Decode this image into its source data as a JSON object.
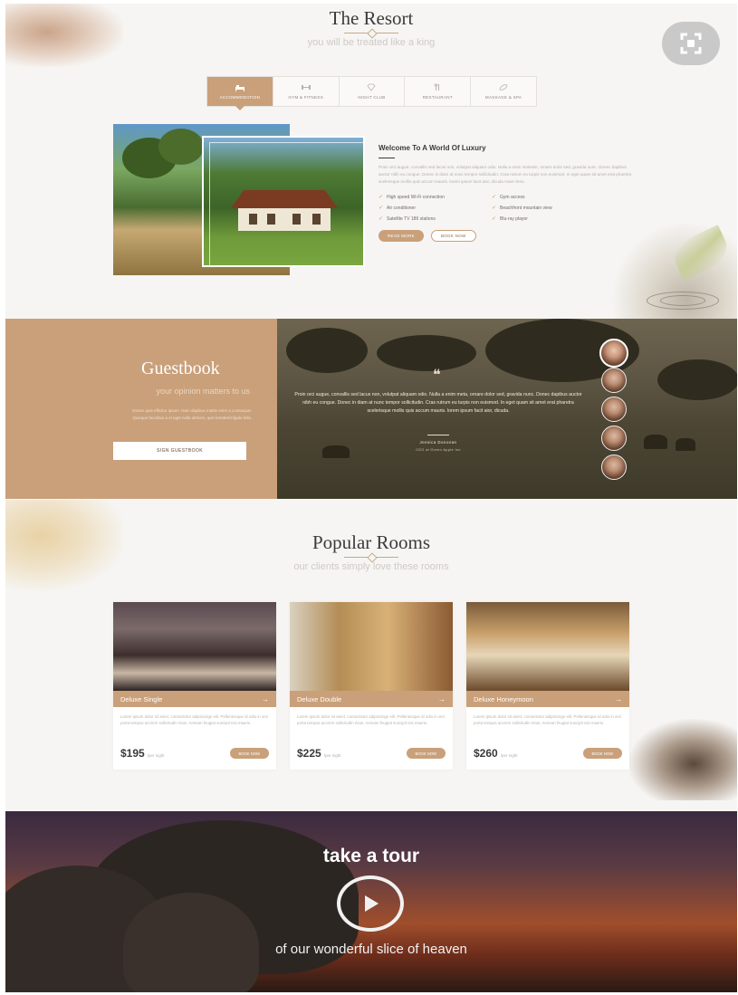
{
  "resort": {
    "title": "The Resort",
    "subtitle": "you will be treated like a king",
    "tabs": [
      {
        "label": "Accommodation",
        "icon": "bed-icon",
        "active": true
      },
      {
        "label": "Gym & Fitness",
        "icon": "dumbbell-icon",
        "active": false
      },
      {
        "label": "Night Club",
        "icon": "diamond-icon",
        "active": false
      },
      {
        "label": "Restaurant",
        "icon": "cutlery-icon",
        "active": false
      },
      {
        "label": "Massage & Spa",
        "icon": "leaf-icon",
        "active": false
      }
    ],
    "welcome_title": "Welcome To A World Of Luxury",
    "welcome_text": "Proin orci augue, convallis sed lacus non, volutpat aliquam odio. Nulla a enim molestie, ornare dolor sed, gravida nunc. Donec dapibus auctor nibh eu congue. Donec in diam at nunc tempor sollicitudin. Cras rutrum eu turpis non euismod. In eget quam sit amet erat pharetra scelerisque mollis quis accum mauris. lorem ipsum facit aior, dicuda maen leno.",
    "features": [
      "High speed Wi-Fi connection",
      "Gym access",
      "Air conditioner",
      "Beachfront mountain view",
      "Satellite TV 186 stations",
      "Blu-ray player"
    ],
    "read_more": "Read more",
    "book_now": "Book now"
  },
  "guestbook": {
    "title": "Guestbook",
    "subtitle": "your opinion matters to us",
    "description": "Donec quis efficitur ipsum. Nam dapibus mattis enim a consequat. Quisque faucibus a id eget nulla ultrices, quis hendrerit ligula felis.",
    "sign_button": "Sign guestbook",
    "quote": "Proin orci augue, convallis sed lacus non, volutpat aliquam odio. Nulla a enim meta, ornare dolor sed, gravida nunc. Donec dapibus auctor nibh eu congue. Donec in diam at nunc tempor sollicitudin. Cras rutrum eu turpis non euismod. In eget quam sit amet erat pharetra scelerisque mollis quis accum mauris. lorem ipsum facit aior, dicuda.",
    "author_name": "Jessica Donovan",
    "author_role": "CEO at Green Apple Inc"
  },
  "rooms": {
    "title": "Popular Rooms",
    "subtitle": "our clients simply love these rooms",
    "items": [
      {
        "name": "Deluxe Single",
        "price": "$195",
        "per": "/per night",
        "book": "Book now",
        "desc": "Lorem ipsum dolor sit amet, consectetur adipiscinge elit. Pellentesque id odio in orci porta tempus accrem sollicitudin risus. Aenean feugiat suscipit nisi mauris."
      },
      {
        "name": "Deluxe Double",
        "price": "$225",
        "per": "/per night",
        "book": "Book now",
        "desc": "Lorem ipsum dolor sit amet, consectetur adipiscinge elit. Pellentesque id odio in orci porta tempus accrem sollicitudin risus. Aenean feugiat suscipit nisi mauris."
      },
      {
        "name": "Deluxe Honeymoon",
        "price": "$260",
        "per": "/per night",
        "book": "Book now",
        "desc": "Lorem ipsum dolor sit amet, consectetur adipiscinge elit. Pellentesque id odio in orci porta tempus accrem sollicitudin risus. Aenean feugiat suscipit nisi mauris."
      }
    ]
  },
  "tour": {
    "title": "take a tour",
    "subtitle": "of our wonderful slice of heaven"
  },
  "colors": {
    "accent": "#c9a07a",
    "heading": "#3b3b3b",
    "background": "#f6f5f3"
  }
}
